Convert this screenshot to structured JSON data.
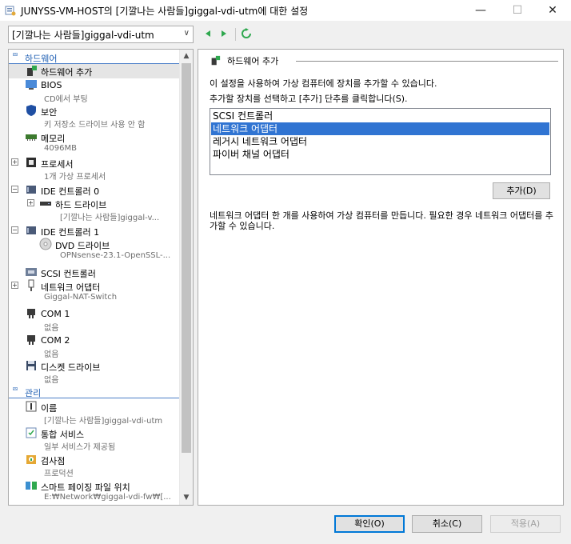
{
  "window": {
    "title": "JUNYSS-VM-HOST의 [기깔나는 사람들]giggal-vdi-utm에 대한 설정",
    "minimize": "—",
    "maximize": "☐",
    "close": "✕"
  },
  "toolbar": {
    "vm_select_value": "[기깔나는 사람들]giggal-vdi-utm"
  },
  "sections": {
    "hardware": "하드웨어",
    "management": "관리"
  },
  "tree": {
    "add_hardware": "하드웨어 추가",
    "bios": "BIOS",
    "bios_sub": "CD에서 부팅",
    "security": "보안",
    "security_sub": "키 저장소 드라이브 사용 안 함",
    "memory": "메모리",
    "memory_sub": "4096MB",
    "processor": "프로세서",
    "processor_sub": "1개 가상 프로세서",
    "ide0": "IDE 컨트롤러 0",
    "hard_drive": "하드 드라이브",
    "hard_drive_sub": "[기깔나는 사람들]giggal-v...",
    "ide1": "IDE 컨트롤러 1",
    "dvd_drive": "DVD 드라이브",
    "dvd_drive_sub": "OPNsense-23.1-OpenSSL-...",
    "scsi": "SCSI 컨트롤러",
    "network": "네트워크 어댑터",
    "network_sub": "Giggal-NAT-Switch",
    "com1": "COM 1",
    "com1_sub": "없음",
    "com2": "COM 2",
    "com2_sub": "없음",
    "diskette": "디스켓 드라이브",
    "diskette_sub": "없음",
    "name": "이름",
    "name_sub": "[기깔나는 사람들]giggal-vdi-utm",
    "integration": "통합 서비스",
    "integration_sub": "일부 서비스가 제공됨",
    "checkpoints": "검사점",
    "checkpoints_sub": "프로덕션",
    "smart_paging": "스마트 페이징 파일 위치",
    "smart_paging_sub": "E:₩Network₩giggal-vdi-fw₩[..."
  },
  "right": {
    "group_title": "하드웨어 추가",
    "intro": "이 설정을 사용하여 가상 컴퓨터에 장치를 추가할 수 있습니다.",
    "instruction": "추가할 장치를 선택하고 [추가] 단추를 클릭합니다(S).",
    "devices": [
      "SCSI 컨트롤러",
      "네트워크 어댑터",
      "레거시 네트워크 어댑터",
      "파이버 채널 어댑터"
    ],
    "selected_device": "네트워크 어댑터",
    "add_button": "추가(D)",
    "description": "네트워크 어댑터 한 개를 사용하여 가상 컴퓨터를 만듭니다. 필요한 경우 네트워크 어댑터를 추가할 수 있습니다."
  },
  "footer": {
    "ok": "확인(O)",
    "cancel": "취소(C)",
    "apply": "적용(A)"
  },
  "colors": {
    "accent": "#3074d2",
    "section_header": "#1f5fb3",
    "nav_arrow": "#2fa84f"
  }
}
